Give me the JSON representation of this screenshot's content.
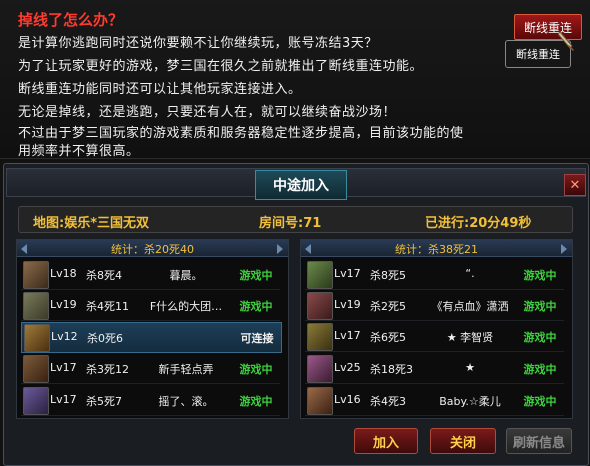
{
  "notice": {
    "title": "掉线了怎么办？",
    "lines": [
      "是计算你逃跑同时还说你要赖不让你继续玩，账号冻结3天？",
      "为了让玩家更好的游戏，梦三国在很久之前就推出了断线重连功能。",
      "断线重连功能同时还可以让其他玩家连接进入。",
      "无论是掉线，还是逃跑，只要还有人在，就可以继续奋战沙场！",
      "不过由于梦三国玩家的游戏素质和服务器稳定性逐步提高，目前该功能的使",
      "用频率并不算很高。"
    ],
    "reconnect_button": "断线重连",
    "tooltip": "断线重连"
  },
  "dialog": {
    "title": "中途加入",
    "map": "地图:娱乐*三国无双",
    "room": "房间号:71",
    "elapsed": "已进行:20分49秒",
    "buttons": {
      "join": "加入",
      "close": "关闭",
      "refresh": "刷新信息"
    }
  },
  "teams": [
    {
      "stat": "统计：杀20死40",
      "players": [
        {
          "level": "Lv18",
          "kd": "杀8死4",
          "name": "暮晨。",
          "status": "游戏中",
          "avatar_color": "#6a4a3a"
        },
        {
          "level": "Lv19",
          "kd": "杀4死11",
          "name": "F什么的大团…",
          "status": "游戏中",
          "avatar_color": "#5a5a3a"
        },
        {
          "level": "Lv12",
          "kd": "杀0死6",
          "name": "",
          "status": "可连接",
          "avatar_color": "#7a5a2a"
        },
        {
          "level": "Lv17",
          "kd": "杀3死12",
          "name": "新手轻点弄",
          "status": "游戏中",
          "avatar_color": "#5a3a2a"
        },
        {
          "level": "Lv17",
          "kd": "杀5死7",
          "name": "摇了、滚。",
          "status": "游戏中",
          "avatar_color": "#4a3a6a"
        }
      ]
    },
    {
      "stat": "统计：杀38死21",
      "players": [
        {
          "level": "Lv17",
          "kd": "杀8死5",
          "name": "“.",
          "status": "游戏中",
          "avatar_color": "#4a6a3a"
        },
        {
          "level": "Lv19",
          "kd": "杀2死5",
          "name": "《有点血》潇洒",
          "status": "游戏中",
          "avatar_color": "#6a3a3a"
        },
        {
          "level": "Lv17",
          "kd": "杀6死5",
          "name": "★ 李智贤",
          "status": "游戏中",
          "avatar_color": "#6a5a2a"
        },
        {
          "level": "Lv25",
          "kd": "杀18死3",
          "name": "★",
          "status": "游戏中",
          "avatar_color": "#7a4a6a"
        },
        {
          "level": "Lv16",
          "kd": "杀4死3",
          "name": "Baby.☆柔儿",
          "status": "游戏中",
          "avatar_color": "#7a4a3a"
        }
      ]
    }
  ],
  "colors": {
    "accent_gold": "#f2c038",
    "status_green": "#3ecf3e",
    "title_red": "#ff3b2f"
  }
}
